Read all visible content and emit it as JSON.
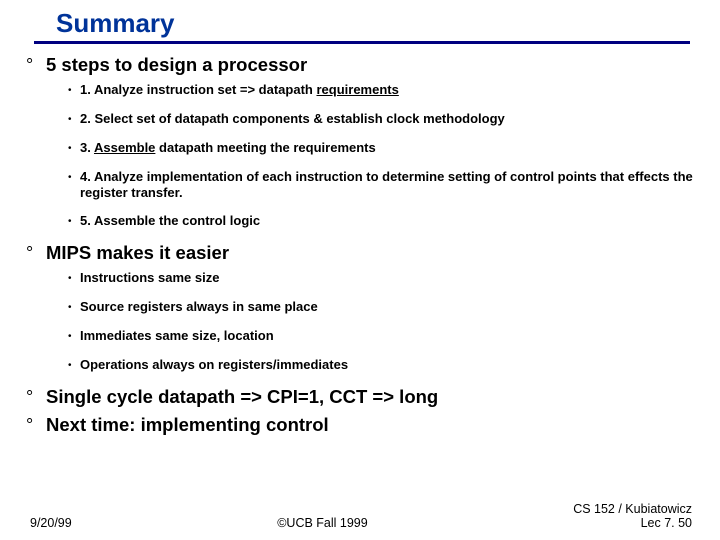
{
  "title": "Summary",
  "sections": [
    {
      "heading": "5 steps to design a processor",
      "items": [
        {
          "pre": "1. Analyze instruction set => datapath ",
          "u": "requirements",
          "post": ""
        },
        {
          "pre": "2. Select set of datapath components & establish clock methodology",
          "u": "",
          "post": ""
        },
        {
          "pre": "3. ",
          "u": "Assemble",
          "post": " datapath meeting the requirements"
        },
        {
          "pre": "4. Analyze implementation of each instruction to determine setting of control points that effects the register transfer.",
          "u": "",
          "post": ""
        },
        {
          "pre": "5. Assemble the control logic",
          "u": "",
          "post": ""
        }
      ]
    },
    {
      "heading": "MIPS makes it easier",
      "items": [
        {
          "pre": "Instructions same size",
          "u": "",
          "post": ""
        },
        {
          "pre": "Source registers always in same place",
          "u": "",
          "post": ""
        },
        {
          "pre": "Immediates same size, location",
          "u": "",
          "post": ""
        },
        {
          "pre": "Operations always on registers/immediates",
          "u": "",
          "post": ""
        }
      ]
    },
    {
      "heading": "Single cycle datapath => CPI=1, CCT => long",
      "items": []
    },
    {
      "heading": "Next time: implementing control",
      "items": []
    }
  ],
  "footer": {
    "left": "9/20/99",
    "center": "©UCB Fall 1999",
    "right": "CS 152 / Kubiatowicz\nLec 7. 50"
  }
}
